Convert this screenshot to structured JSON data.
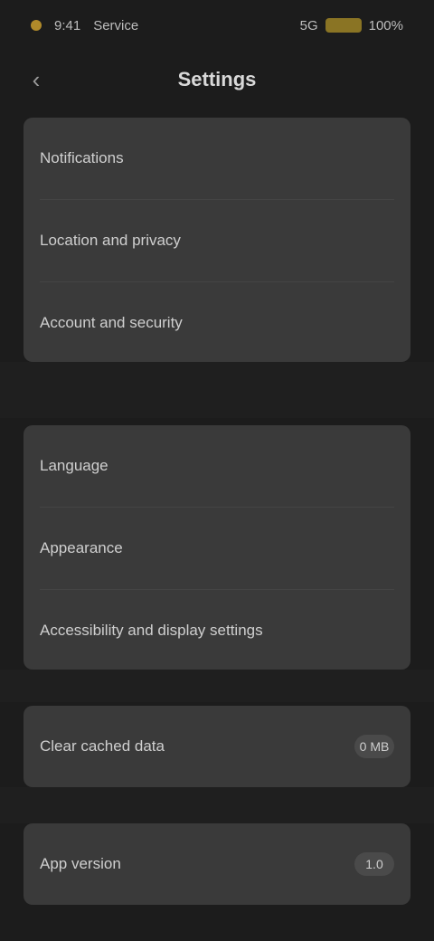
{
  "status_bar": {
    "time": "9:41",
    "carrier": "Service",
    "signal_text": "5G",
    "battery_text": "100%"
  },
  "header": {
    "back_icon": "chevron-left-icon",
    "title": "Settings"
  },
  "group1": {
    "items": [
      {
        "label": "Notifications"
      },
      {
        "label": "Location and privacy"
      },
      {
        "label": "Account and security"
      }
    ]
  },
  "group2": {
    "items": [
      {
        "label": "Language"
      },
      {
        "label": "Appearance"
      },
      {
        "label": "Accessibility and display settings"
      }
    ]
  },
  "group3": {
    "label": "Clear cached data",
    "value": "0 MB"
  },
  "group4": {
    "label": "App version",
    "value": "1.0"
  }
}
